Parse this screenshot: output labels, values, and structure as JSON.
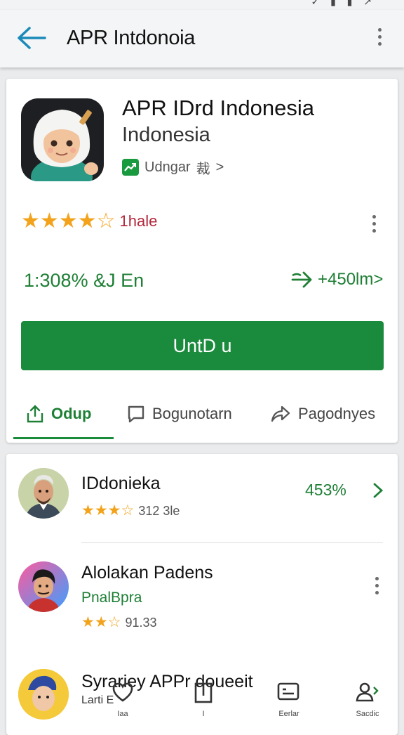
{
  "status_bar": {
    "glyphs": "✓ ▮ ▮ ↗"
  },
  "app_bar": {
    "title": "APR Intdonoia",
    "back_icon": "arrow-back-icon",
    "menu_icon": "more-vert-icon"
  },
  "app": {
    "title": "APR IDrd Indonesia",
    "subtitle": "Indonesia",
    "developer": {
      "label": "Udngar",
      "glyph": "裁",
      "chevron": ">"
    },
    "rating": {
      "stars": 4,
      "max": 5,
      "label": "1hale"
    },
    "stat_left": "1:308% &J En",
    "stat_right": "+450lm>",
    "install_label": "UntD u"
  },
  "tabs": [
    {
      "label": "Odup",
      "icon": "share-icon",
      "active": true
    },
    {
      "label": "Bogunotarn",
      "icon": "message-icon",
      "active": false
    },
    {
      "label": "Pagodnyes",
      "icon": "forward-icon",
      "active": false
    }
  ],
  "list": [
    {
      "title": "IDdonieka",
      "sub": "",
      "stars": 3.5,
      "count": "312 3le",
      "right": "453%",
      "right_icon": "chevron-right-icon"
    },
    {
      "title": "Alolakan Padens",
      "sub": "PnalBpra",
      "stars": 2.5,
      "count": "91.33",
      "right": "",
      "right_icon": "more-vert-icon"
    },
    {
      "title": "Syrariey APPr doueeit",
      "sub": "Larti E",
      "stars": 0,
      "count": "",
      "right": "",
      "right_icon": ""
    }
  ],
  "bottom_nav": [
    {
      "label": "Iaa",
      "icon": "heart-icon"
    },
    {
      "label": "I",
      "icon": "bookmark-icon"
    },
    {
      "label": "Eerlar",
      "icon": "card-icon"
    },
    {
      "label": "Sacdic",
      "icon": "person-icon"
    }
  ],
  "colors": {
    "accent_green": "#1a8a3c",
    "star": "#f2a31b",
    "rating_red": "#b2273b",
    "back_arrow": "#1a8ab8"
  }
}
